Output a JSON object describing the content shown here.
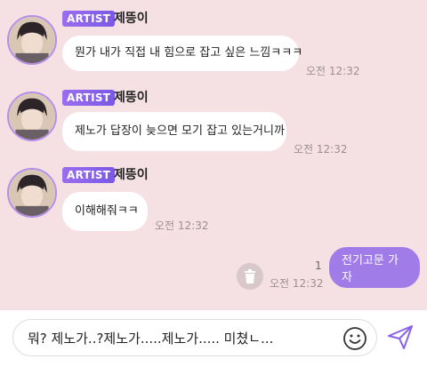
{
  "messages": [
    {
      "badge": "ARTIST",
      "sender": "제뜽이",
      "text": "뭔가 내가 직접 내 힘으로 잡고 싶은 느낌ㅋㅋㅋ",
      "time": "오전 12:32"
    },
    {
      "badge": "ARTIST",
      "sender": "제뜽이",
      "text": "제노가 답장이 늦으면 모기 잡고 있는거니까",
      "time": "오전 12:32"
    },
    {
      "badge": "ARTIST",
      "sender": "제뜽이",
      "text": "이해해줘ㅋㅋ",
      "time": "오전 12:32"
    }
  ],
  "my_message": {
    "text": "전기고문 가자",
    "unread_count": "1",
    "time": "오전 12:32"
  },
  "composer": {
    "text": "뭐? 제노가..?제노가.....제노가..... 미쳤ㄴ..."
  },
  "colors": {
    "background": "#f5e1e4",
    "accent": "#a07ce8",
    "badge": "#8a62ea"
  },
  "icons": [
    "avatar-image",
    "trash-icon",
    "emoji-icon",
    "send-icon"
  ]
}
